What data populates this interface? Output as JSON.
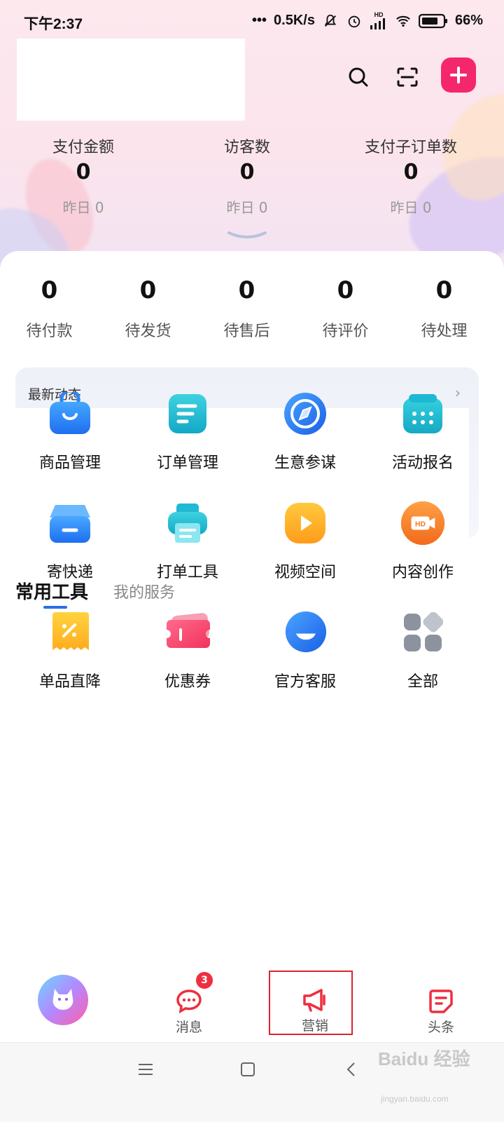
{
  "status_bar": {
    "time": "下午2:37",
    "speed": "0.5K/s",
    "hd": "HD",
    "battery": "66%"
  },
  "stats": [
    {
      "label": "支付金额",
      "value": "0",
      "sub": "昨日 0"
    },
    {
      "label": "访客数",
      "value": "0",
      "sub": "昨日 0"
    },
    {
      "label": "支付子订单数",
      "value": "0",
      "sub": "昨日 0"
    }
  ],
  "orders": [
    {
      "value": "0",
      "label": "待付款"
    },
    {
      "value": "0",
      "label": "待发货"
    },
    {
      "value": "0",
      "label": "待售后"
    },
    {
      "value": "0",
      "label": "待评价"
    },
    {
      "value": "0",
      "label": "待处理"
    }
  ],
  "news": {
    "title": "最新动态",
    "arrow": "›"
  },
  "tabs": {
    "active": "常用工具",
    "other": "我的服务"
  },
  "tools": [
    {
      "label": "商品管理",
      "icon": "shopping-bag-icon"
    },
    {
      "label": "订单管理",
      "icon": "order-list-icon"
    },
    {
      "label": "生意参谋",
      "icon": "compass-icon"
    },
    {
      "label": "活动报名",
      "icon": "calendar-icon"
    },
    {
      "label": "寄快递",
      "icon": "package-box-icon"
    },
    {
      "label": "打单工具",
      "icon": "printer-icon"
    },
    {
      "label": "视频空间",
      "icon": "play-icon"
    },
    {
      "label": "内容创作",
      "icon": "hd-video-icon"
    },
    {
      "label": "单品直降",
      "icon": "discount-tag-icon"
    },
    {
      "label": "优惠券",
      "icon": "coupon-icon"
    },
    {
      "label": "官方客服",
      "icon": "headset-icon"
    },
    {
      "label": "全部",
      "icon": "grid-all-icon"
    }
  ],
  "bottom_nav": {
    "messages": {
      "label": "消息",
      "badge": "3"
    },
    "marketing": {
      "label": "营销"
    },
    "headlines": {
      "label": "头条"
    }
  },
  "watermark": {
    "text": "Baidu 经验",
    "url": "jingyan.baidu.com"
  },
  "colors": {
    "accent": "#f5276c",
    "tab_underline": "#2a6fe8",
    "badge": "#ee2f3f",
    "highlight_box": "#d9252e"
  }
}
